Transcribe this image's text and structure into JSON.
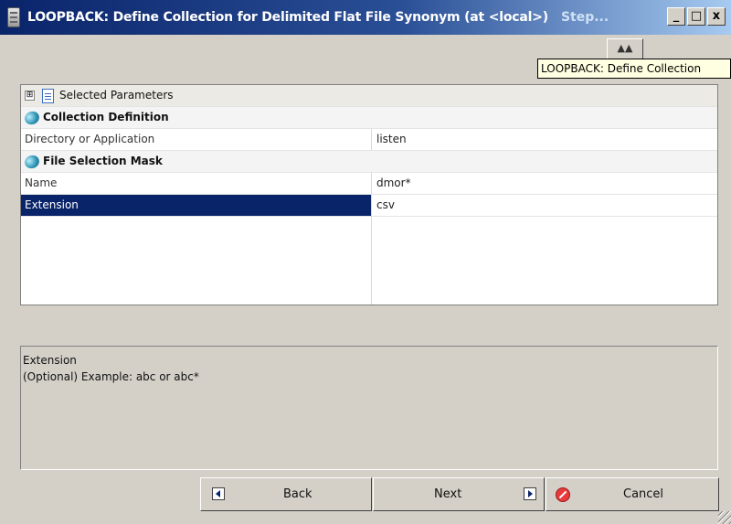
{
  "window": {
    "title": "LOOPBACK: Define Collection for Delimited Flat File Synonym (at <local>)",
    "title_suffix": "Step...",
    "minimize_glyph": "_",
    "maximize_glyph": "□",
    "close_glyph": "x"
  },
  "toolbar": {
    "help_glyph": "▲▲"
  },
  "tooltip": {
    "text": "LOOPBACK: Define Collection"
  },
  "grid": {
    "header": {
      "label": "Selected Parameters",
      "expander_glyph": "⊞"
    },
    "sections": [
      {
        "title": "Collection Definition",
        "rows": [
          {
            "name": "Directory or Application",
            "value": "listen"
          }
        ]
      },
      {
        "title": "File Selection Mask",
        "rows": [
          {
            "name": "Name",
            "value": "dmor*"
          },
          {
            "name": "Extension",
            "value": "csv",
            "selected": true
          }
        ]
      }
    ]
  },
  "description": {
    "title": "Extension",
    "text": "(Optional) Example: abc or abc*"
  },
  "buttons": {
    "back": "Back",
    "next": "Next",
    "cancel": "Cancel"
  },
  "colors": {
    "title_bar": "#0a246a",
    "selection": "#0a246a",
    "tooltip_bg": "#ffffe1",
    "face": "#d4d0c8"
  }
}
